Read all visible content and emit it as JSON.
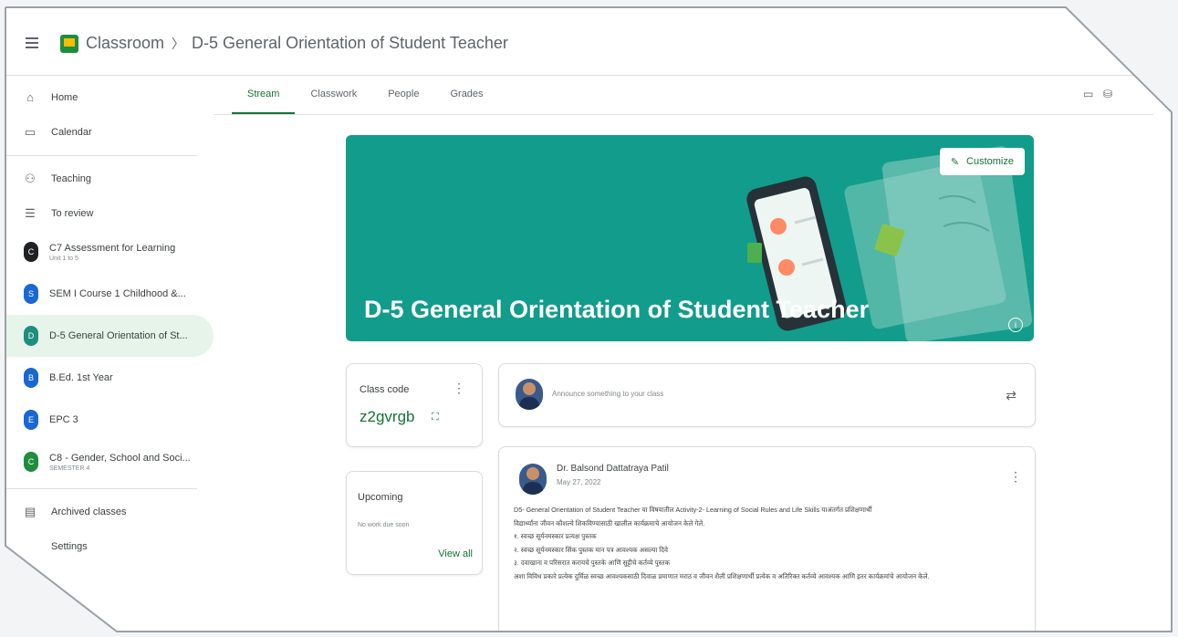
{
  "app": {
    "name": "Classroom",
    "class_title": "D-5 General Orientation of Student Teacher"
  },
  "sidebar": {
    "home": "Home",
    "calendar": "Calendar",
    "teaching": "Teaching",
    "to_review": "To review",
    "classes": [
      {
        "initial": "C",
        "name": "C7 Assessment for Learning",
        "sub": "Unit 1 to 5",
        "color": "#202124"
      },
      {
        "initial": "S",
        "name": "SEM I Course 1 Childhood &...",
        "sub": "",
        "color": "#1967d2"
      },
      {
        "initial": "D",
        "name": "D-5 General Orientation of St...",
        "sub": "",
        "color": "#1e8e7e"
      },
      {
        "initial": "B",
        "name": "B.Ed. 1st Year",
        "sub": "",
        "color": "#1967d2"
      },
      {
        "initial": "E",
        "name": "EPC 3",
        "sub": "",
        "color": "#1967d2"
      },
      {
        "initial": "C",
        "name": "C8 - Gender, School and Soci...",
        "sub": "SEMESTER 4",
        "color": "#1e8e3e"
      }
    ],
    "archived": "Archived classes",
    "settings": "Settings"
  },
  "tabs": [
    {
      "label": "Stream"
    },
    {
      "label": "Classwork"
    },
    {
      "label": "People"
    },
    {
      "label": "Grades"
    }
  ],
  "banner": {
    "title": "D-5 General Orientation of Student Teacher",
    "customize": "Customize",
    "color": "#129c8b"
  },
  "class_code": {
    "label": "Class code",
    "code": "z2gvrgb"
  },
  "upcoming": {
    "label": "Upcoming",
    "none": "No work due soon",
    "view_all": "View all"
  },
  "announce": {
    "placeholder": "Announce something to your class"
  },
  "post": {
    "author": "Dr. Balsond Dattatraya Patil",
    "date": "May 27, 2022",
    "lines": [
      "D5- General Orientation of Student Teacher या विषयातील Activity-2- Learning of Social Rules and Life Skills याअंतर्गत प्रशिक्षणार्थी",
      "विद्यार्थ्यांना जीवन कौशल्ये शिकविण्यासाठी खालील कार्यक्रमाचे आयोजन केले गेले.",
      "१. स्वच्छ सूर्यनमस्कार प्रत्यक्ष पुस्तक",
      "२. स्वच्छ सूर्यनमस्कार सिंक पुस्तक मान पत्र आवश्यक असल्या दिवे",
      "३. दवाखाना व परिसरात करायचे पुस्तके आणि सुट्टीचे कर्तव्ये पुस्तक",
      "अशा विविध प्रकारे प्रत्येक दुर्मिळ स्वच्छ आवश्यकसाठी दिवाळ प्रमाणात मराठ व जीवन शैली प्रशिक्षणार्थी प्रत्येक व अतिरिक्त कर्तव्ये आवश्यक आणि इतर कार्यक्रमांचे आयोजन केले."
    ]
  }
}
